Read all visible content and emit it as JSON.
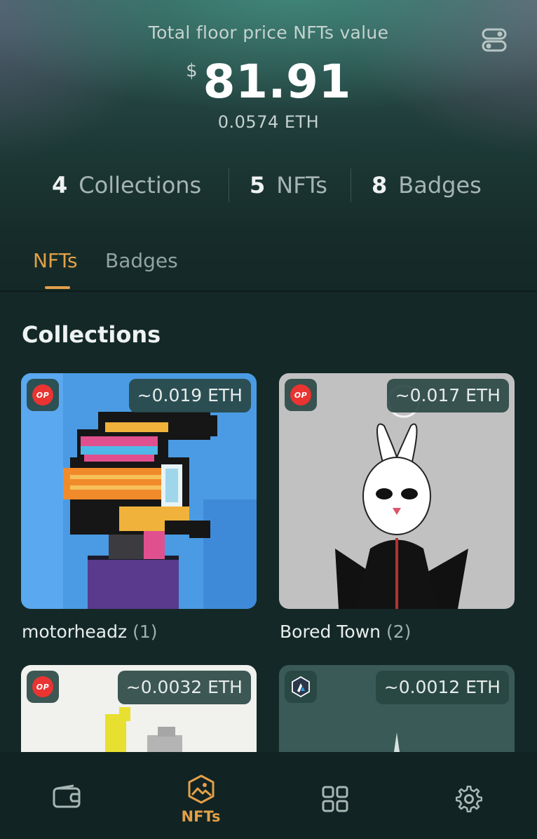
{
  "summary": {
    "title": "Total floor price NFTs value",
    "currency_symbol": "$",
    "amount": "81.91",
    "eth_value": "0.0574 ETH"
  },
  "stats": [
    {
      "count": "4",
      "label": "Collections"
    },
    {
      "count": "5",
      "label": "NFTs"
    },
    {
      "count": "8",
      "label": "Badges"
    }
  ],
  "tabs": [
    {
      "label": "NFTs",
      "active": true
    },
    {
      "label": "Badges",
      "active": false
    }
  ],
  "section_title": "Collections",
  "collections": [
    {
      "name": "motorheadz",
      "count": "(1)",
      "price": "~0.019 ETH",
      "chain": "OP"
    },
    {
      "name": "Bored Town",
      "count": "(2)",
      "price": "~0.017 ETH",
      "chain": "OP"
    },
    {
      "name": "",
      "count": "",
      "price": "~0.0032 ETH",
      "chain": "OP"
    },
    {
      "name": "",
      "count": "",
      "price": "~0.0012 ETH",
      "chain": "arbitrum-icon"
    }
  ],
  "bottom_nav": [
    {
      "icon": "wallet-icon",
      "label": ""
    },
    {
      "icon": "nft-image-icon",
      "label": "NFTs",
      "active": true
    },
    {
      "icon": "apps-grid-icon",
      "label": ""
    },
    {
      "icon": "settings-gear-icon",
      "label": ""
    }
  ],
  "colors": {
    "accent": "#e2a04a",
    "background": "#142927",
    "op_red": "#ea3431"
  }
}
